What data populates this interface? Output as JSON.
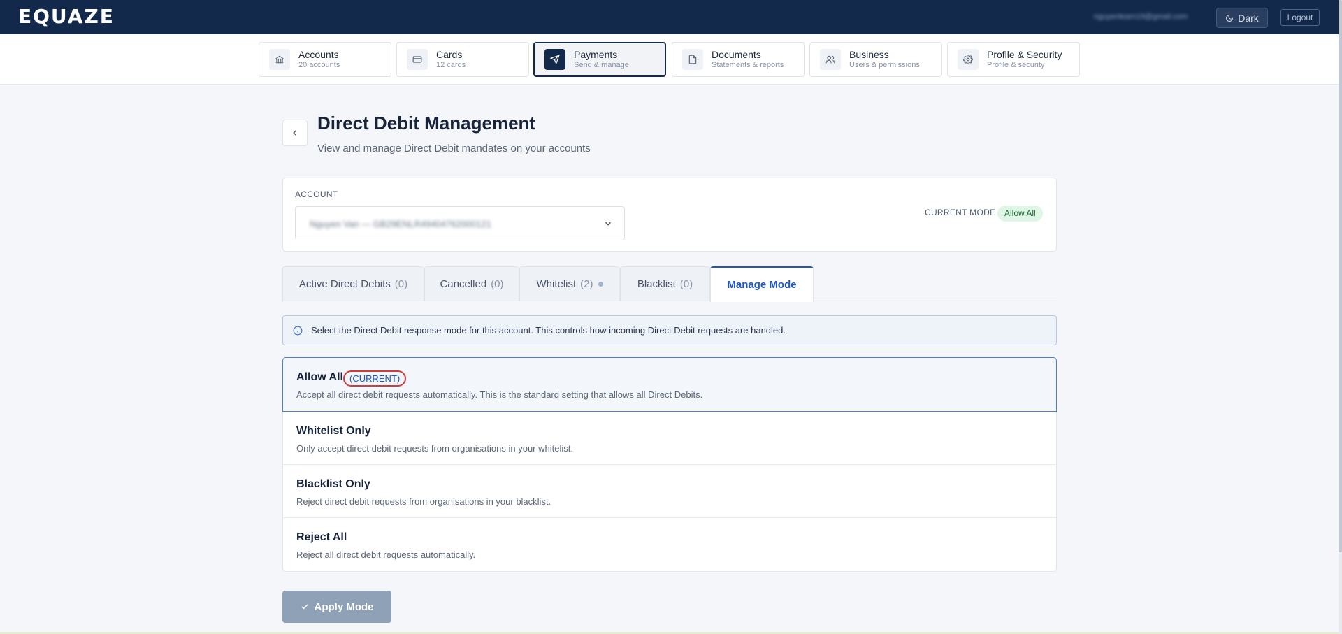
{
  "app": {
    "logo_text": "EQUAZE"
  },
  "header": {
    "user_email": "nguyenlearn19@gmail.com",
    "theme_label": "Dark",
    "logout_label": "Logout"
  },
  "nav": {
    "items": [
      {
        "title": "Accounts",
        "subtitle": "20 accounts",
        "icon": "bank-icon"
      },
      {
        "title": "Cards",
        "subtitle": "12 cards",
        "icon": "card-icon"
      },
      {
        "title": "Payments",
        "subtitle": "Send & manage",
        "icon": "send-icon",
        "active": true
      },
      {
        "title": "Documents",
        "subtitle": "Statements & reports",
        "icon": "document-icon"
      },
      {
        "title": "Business",
        "subtitle": "Users & permissions",
        "icon": "users-icon"
      },
      {
        "title": "Profile & Security",
        "subtitle": "Profile & security",
        "icon": "gear-icon"
      }
    ]
  },
  "page": {
    "title": "Direct Debit Management",
    "subtitle": "View and manage Direct Debit mandates on your accounts"
  },
  "account": {
    "label": "ACCOUNT",
    "selected_value": "Nguyen Van — GB29ENLR49404762000121",
    "current_mode_label": "CURRENT MODE",
    "current_mode_value": "Allow All"
  },
  "tabs": [
    {
      "label": "Active Direct Debits",
      "count": "(0)"
    },
    {
      "label": "Cancelled",
      "count": "(0)"
    },
    {
      "label": "Whitelist",
      "count": "(2)"
    },
    {
      "label": "Blacklist",
      "count": "(0)"
    },
    {
      "label": "Manage Mode",
      "count": "",
      "active": true
    }
  ],
  "info": {
    "text": "Select the Direct Debit response mode for this account. This controls how incoming Direct Debit requests are handled."
  },
  "modes": [
    {
      "title": "Allow All",
      "tag": "(CURRENT)",
      "description": "Accept all direct debit requests automatically. This is the standard setting that allows all Direct Debits.",
      "selected": true
    },
    {
      "title": "Whitelist Only",
      "description": "Only accept direct debit requests from organisations in your whitelist."
    },
    {
      "title": "Blacklist Only",
      "description": "Reject direct debit requests from organisations in your blacklist."
    },
    {
      "title": "Reject All",
      "description": "Reject all direct debit requests automatically."
    }
  ],
  "actions": {
    "apply_label": "Apply Mode"
  },
  "colors": {
    "header_bg": "#13294b",
    "accent": "#1f57c5",
    "success_bg": "#dff5e6",
    "highlight_ring": "#d13b3b"
  }
}
